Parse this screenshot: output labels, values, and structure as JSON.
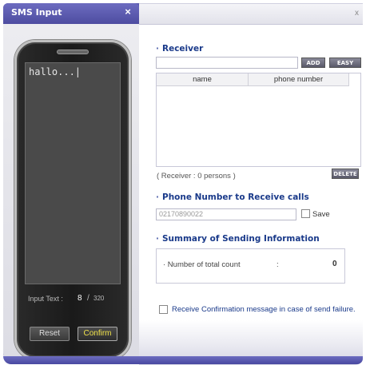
{
  "window": {
    "tab_title": "SMS Input",
    "tab_close": "×",
    "right_close": "x"
  },
  "phone": {
    "message_text": "hallo...|",
    "input_text_label": "Input Text :",
    "count_current": "8",
    "count_separator": "/",
    "count_max": "320",
    "reset_label": "Reset",
    "confirm_label": "Confirm"
  },
  "receiver": {
    "title": "Receiver",
    "bullet": "·",
    "input_value": "",
    "add_label": "ADD",
    "easy_add_label": "EASY ADD",
    "columns": [
      "name",
      "phone number"
    ],
    "rows": [],
    "count_text": "( Receiver :    0 persons )",
    "delete_label": "DELETE"
  },
  "callback": {
    "title": "Phone Number to Receive calls",
    "number": "02170890022",
    "save_label": "Save",
    "save_checked": false
  },
  "summary": {
    "title": "Summary of Sending Information",
    "total_label": "· Number of total count",
    "colon": ":",
    "total_value": "0"
  },
  "options": {
    "confirm_on_failure_label": "Receive Confirmation message in case of send failure.",
    "confirm_on_failure_checked": false
  },
  "colors": {
    "accent": "#4a4a9c",
    "title_blue": "#1a3a8a",
    "confirm_text": "#f0e24a"
  }
}
